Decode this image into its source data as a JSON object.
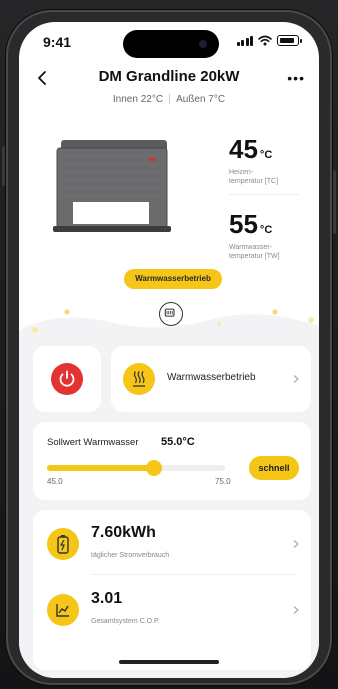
{
  "status_bar": {
    "time": "9:41"
  },
  "header": {
    "title": "DM Grandline 20kW"
  },
  "ambient": {
    "indoor": "Innen 22°C",
    "outdoor": "Außen 7°C"
  },
  "heating": {
    "value": "45",
    "unit": "°C",
    "label": "Heizen-\ntemperatur [TC]"
  },
  "hot_water": {
    "value": "55",
    "unit": "°C",
    "label": "Warmwasser-\ntemperatur [TW]"
  },
  "mode_badge": {
    "label": "Warmwasserbetrieb"
  },
  "mode_card": {
    "label": "Warmwasserbetrieb"
  },
  "setpoint": {
    "label": "Sollwert Warmwasser",
    "value": "55.0°C",
    "min": "45.0",
    "max": "75.0",
    "fraction": 0.6,
    "fast_label": "schnell"
  },
  "stats": [
    {
      "value": "7.60kWh",
      "label": "täglicher Stromverbrauch",
      "icon": "battery-charge-icon"
    },
    {
      "value": "3.01",
      "label": "Gesamtsystem C.O.P.",
      "icon": "trend-chart-icon"
    }
  ],
  "colors": {
    "accent": "#f5c518",
    "power": "#e23232"
  }
}
